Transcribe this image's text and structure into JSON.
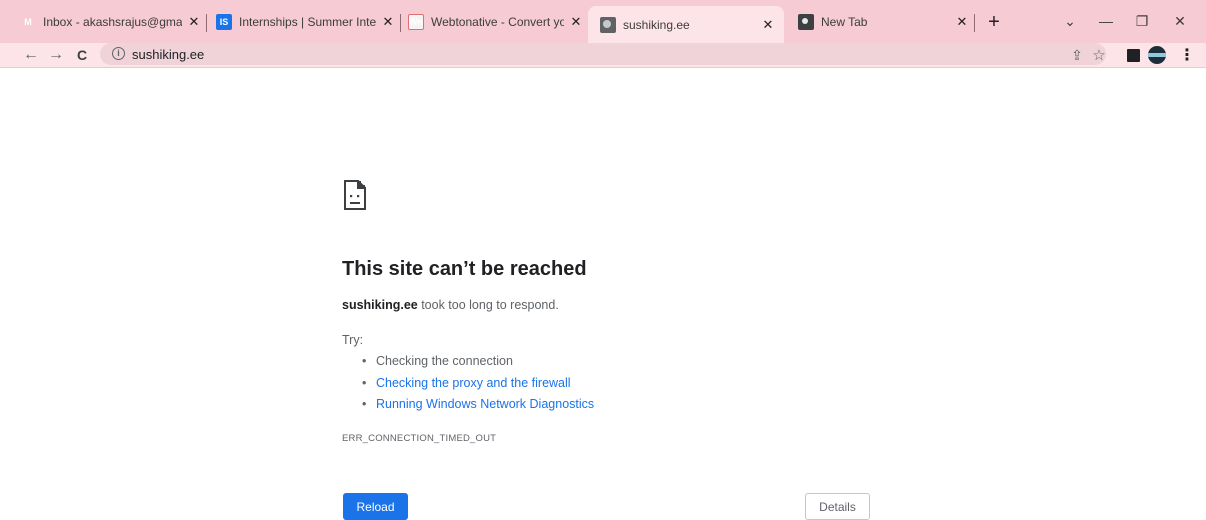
{
  "browser": {
    "tabs": [
      {
        "title": "Inbox - akashsrajus@gmail.co",
        "icon": "gmail-icon",
        "active": false
      },
      {
        "title": "Internships | Summer Interns",
        "icon": "internshala-icon",
        "active": false
      },
      {
        "title": "Webtonative - Convert your",
        "icon": "webtonative-icon",
        "active": false
      },
      {
        "title": "sushiking.ee",
        "icon": "globe-icon",
        "active": true
      },
      {
        "title": "New Tab",
        "icon": "chrome-icon",
        "active": false
      }
    ],
    "tab_close_glyph": "✕",
    "new_tab_glyph": "+",
    "window_controls": {
      "dropdown": "⌄",
      "minimize": "—",
      "restore": "❐",
      "close": "✕"
    },
    "toolbar": {
      "back_glyph": "←",
      "forward_glyph": "→",
      "reload_glyph": "C",
      "info_glyph": "i",
      "url": "sushiking.ee",
      "share_glyph": "⇪",
      "bookmark_glyph": "☆",
      "menu_glyph": "⋮"
    },
    "colors": {
      "tabstrip": "#f6cbd4",
      "toolbar": "#fde4e9",
      "accent": "#1a73e8"
    }
  },
  "error_page": {
    "title": "This site can’t be reached",
    "host": "sushiking.ee",
    "description_suffix": " took too long to respond.",
    "try_label": "Try:",
    "suggestions": [
      {
        "text": "Checking the connection",
        "link": false
      },
      {
        "text": "Checking the proxy and the firewall",
        "link": true
      },
      {
        "text": "Running Windows Network Diagnostics",
        "link": true
      }
    ],
    "error_code": "ERR_CONNECTION_TIMED_OUT",
    "reload_label": "Reload",
    "details_label": "Details"
  }
}
